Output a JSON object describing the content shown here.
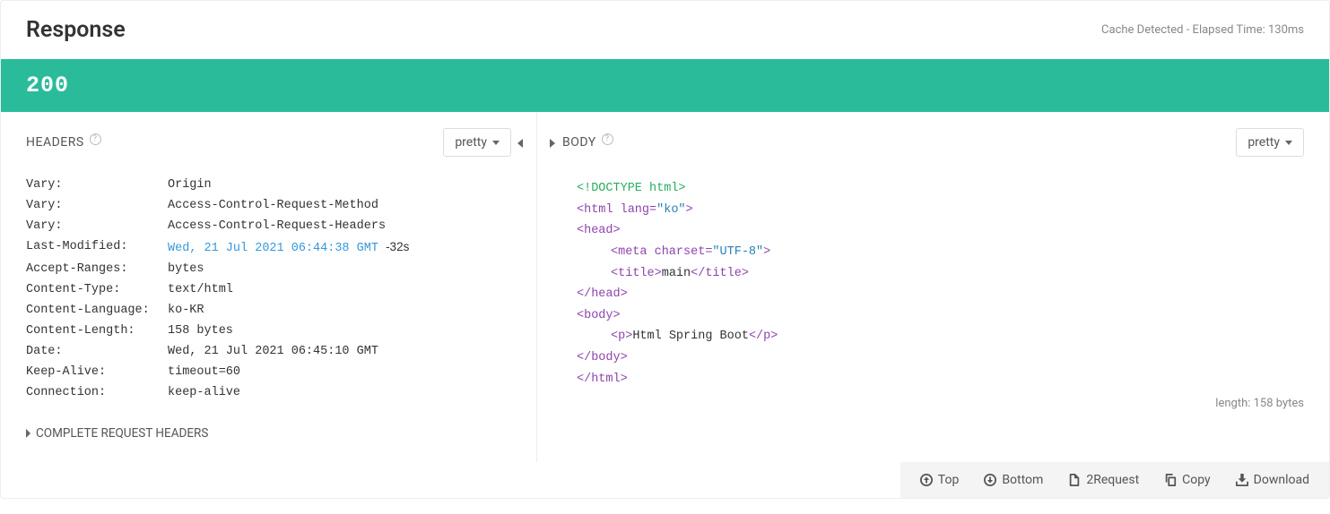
{
  "title": "Response",
  "cache_info": "Cache Detected - Elapsed Time: 130ms",
  "status_code": "200",
  "headers_panel": {
    "title": "HEADERS",
    "dropdown": "pretty",
    "rows": [
      {
        "key": "Vary:",
        "val": "Origin"
      },
      {
        "key": "Vary:",
        "val": "Access-Control-Request-Method"
      },
      {
        "key": "Vary:",
        "val": "Access-Control-Request-Headers"
      },
      {
        "key": "Last-Modified:",
        "val": "Wed, 21 Jul 2021 06:44:38 GMT",
        "age": "-32s",
        "link": true
      },
      {
        "key": "Accept-Ranges:",
        "val": "bytes"
      },
      {
        "key": "Content-Type:",
        "val": "text/html"
      },
      {
        "key": "Content-Language:",
        "val": "ko-KR"
      },
      {
        "key": "Content-Length:",
        "val": "158 bytes"
      },
      {
        "key": "Date:",
        "val": "Wed, 21 Jul 2021 06:45:10 GMT"
      },
      {
        "key": "Keep-Alive:",
        "val": "timeout=60"
      },
      {
        "key": "Connection:",
        "val": "keep-alive"
      }
    ],
    "complete": "COMPLETE REQUEST HEADERS"
  },
  "body_panel": {
    "title": "BODY",
    "dropdown": "pretty",
    "length": "length: 158 bytes",
    "lines": {
      "l0": "<!DOCTYPE html>",
      "l1_open": "<html ",
      "l1_attr": "lang=",
      "l1_val": "\"ko\"",
      "l1_close": ">",
      "l2": "<head>",
      "l3_open": "<meta ",
      "l3_attr": "charset=",
      "l3_val": "\"UTF-8\"",
      "l3_close": ">",
      "l4_open": "<title>",
      "l4_text": "main",
      "l4_close": "</title>",
      "l5": "</head>",
      "l6": "<body>",
      "l7_open": "<p>",
      "l7_text": "Html Spring Boot",
      "l7_close": "</p>",
      "l8": "</body>",
      "l9": "</html>"
    }
  },
  "footer": {
    "top": "Top",
    "bottom": "Bottom",
    "request": "2Request",
    "copy": "Copy",
    "download": "Download"
  }
}
